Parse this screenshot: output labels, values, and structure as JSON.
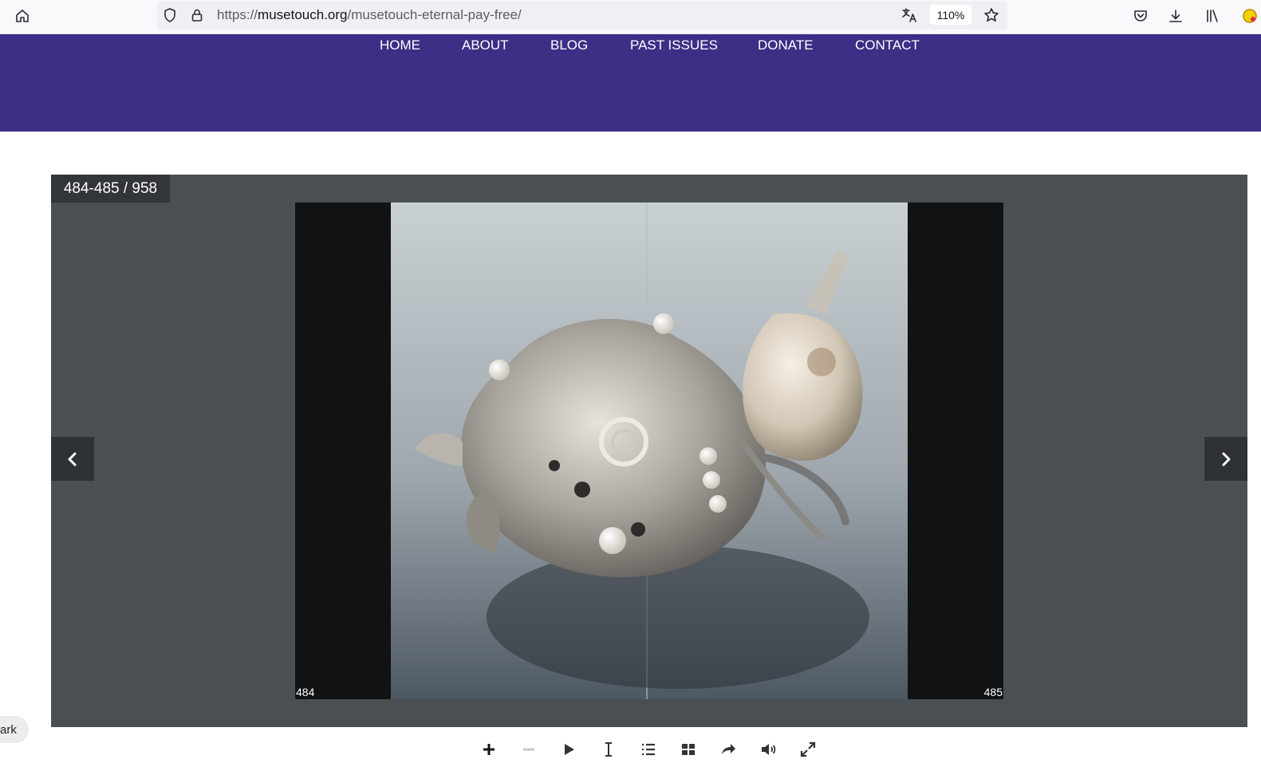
{
  "browser": {
    "url_scheme": "https://",
    "url_domain": "musetouch.org",
    "url_path": "/musetouch-eternal-pay-free/",
    "zoom": "110%",
    "icons": [
      "home-icon",
      "shield-icon",
      "lock-icon",
      "translate-icon",
      "star-icon",
      "pocket-icon",
      "download-icon",
      "library-icon",
      "extension-icon"
    ]
  },
  "site": {
    "brand_color": "#3d2e86",
    "nav": [
      "HOME",
      "ABOUT",
      "BLOG",
      "PAST ISSUES",
      "DONATE",
      "CONTACT"
    ]
  },
  "viewer": {
    "page_counter": "484-485 / 958",
    "left_page_number": "484",
    "right_page_number": "485",
    "image_subject": "silver brooch with pearls and sea shell"
  },
  "toolbar": {
    "icons": [
      "zoom-in-icon",
      "zoom-out-icon",
      "play-icon",
      "text-select-icon",
      "table-of-contents-icon",
      "thumbnails-icon",
      "share-icon",
      "sound-icon",
      "fullscreen-icon"
    ]
  },
  "bookmark_label": "ark"
}
